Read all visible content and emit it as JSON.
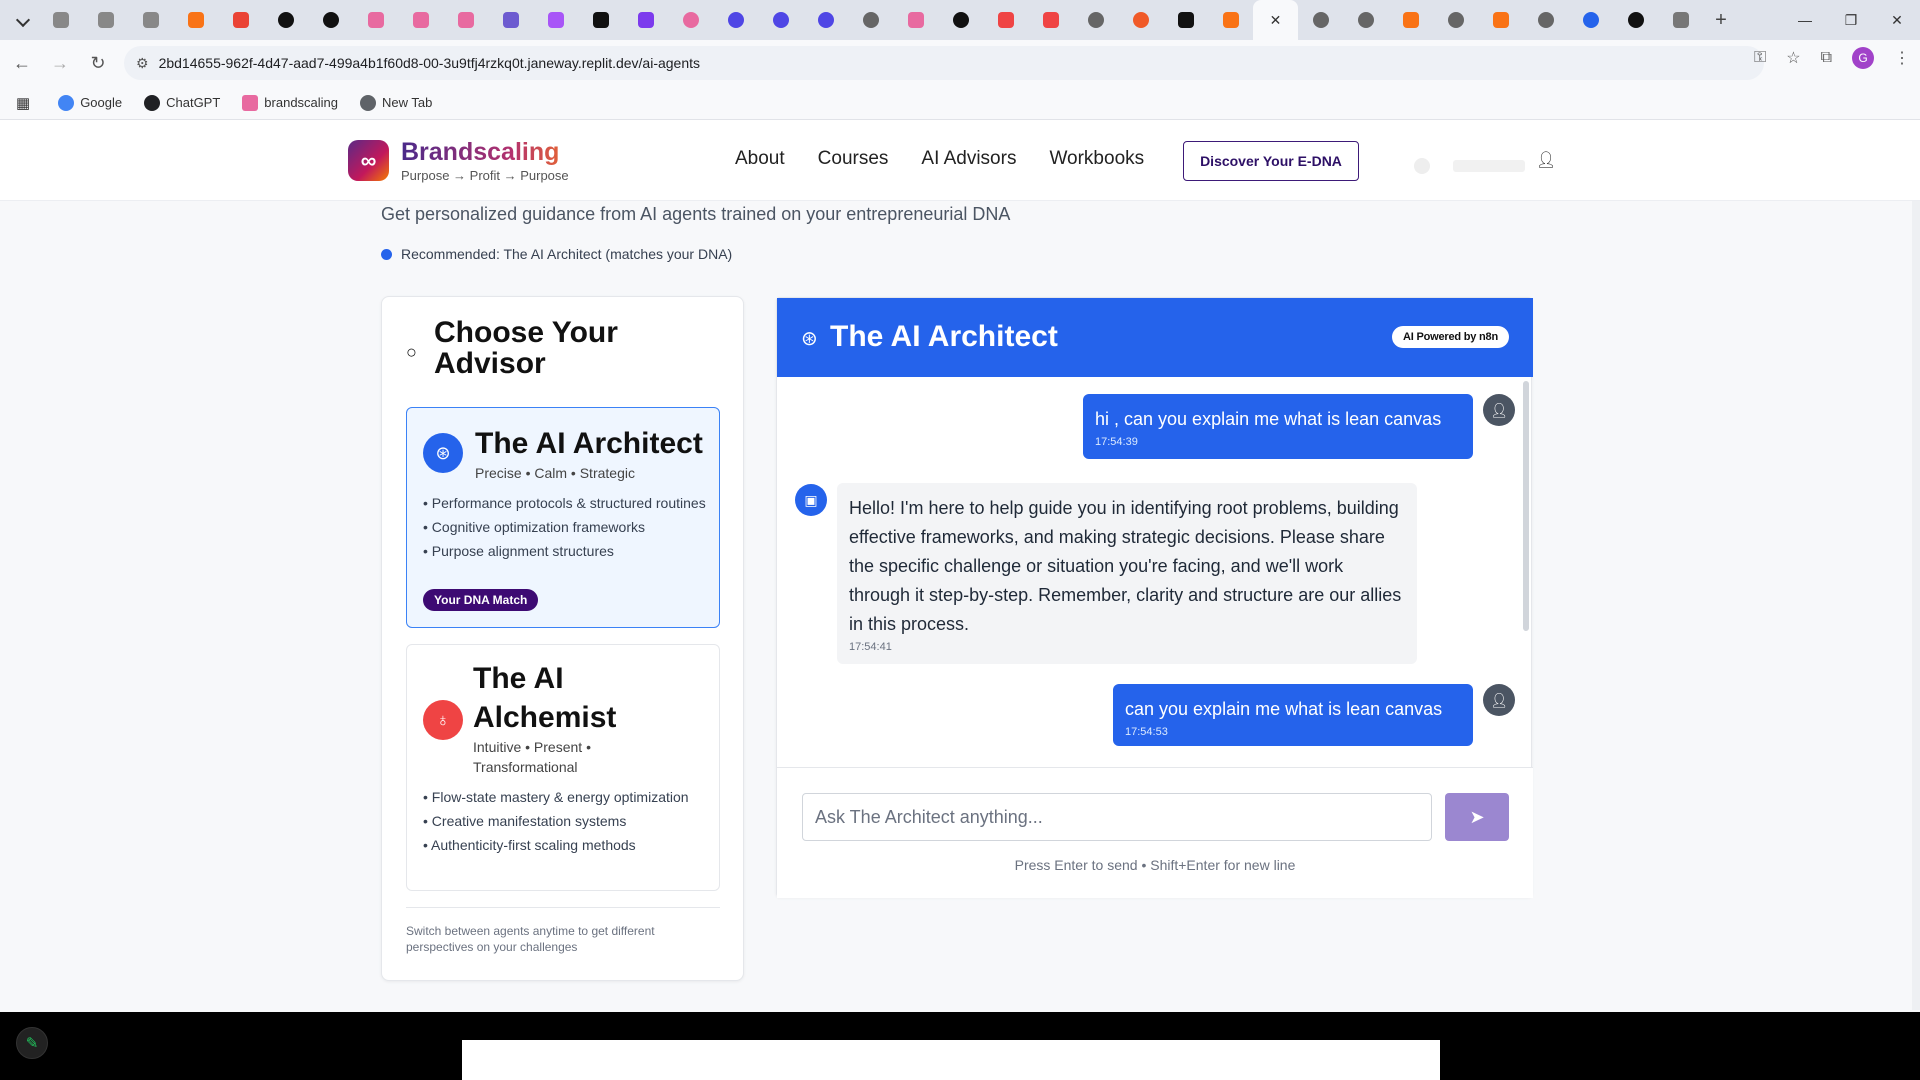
{
  "browser": {
    "url": "2bd14655-962f-4d47-aad7-499a4b1f60d8-00-3u9tfj4rzkq0t.janeway.replit.dev/ai-agents",
    "bookmarks": [
      {
        "label": "Google",
        "icon": "google-icon",
        "color": "#4285f4"
      },
      {
        "label": "ChatGPT",
        "icon": "chatgpt-icon",
        "color": "#202124"
      },
      {
        "label": "brandscaling",
        "icon": "brandscaling-icon",
        "color": "#e86aa0"
      },
      {
        "label": "New Tab",
        "icon": "globe-icon",
        "color": "#5f6368"
      }
    ],
    "profile_initial": "G"
  },
  "site": {
    "brand": "Brandscaling",
    "tagline": "Purpose → Profit → Purpose",
    "nav": [
      "About",
      "Courses",
      "AI Advisors",
      "Workbooks"
    ],
    "cta": "Discover Your E-DNA"
  },
  "hero": {
    "subtitle": "Get personalized guidance from AI agents trained on your entrepreneurial DNA",
    "recommendation": "Recommended: The AI Architect (matches your DNA)"
  },
  "advisor_panel": {
    "title": "Choose Your Advisor",
    "advisors": [
      {
        "name": "The AI Architect",
        "traits": "Precise • Calm • Strategic",
        "points": [
          "Performance protocols & structured routines",
          "Cognitive optimization frameworks",
          "Purpose alignment structures"
        ],
        "badge": "Your DNA Match",
        "accent": "#2563eb"
      },
      {
        "name": "The AI Alchemist",
        "traits": "Intuitive • Present • Transformational",
        "points": [
          "Flow-state mastery & energy optimization",
          "Creative manifestation systems",
          "Authenticity-first scaling methods"
        ],
        "accent": "#ef4444"
      }
    ],
    "footer": "Switch between agents anytime to get different perspectives on your challenges"
  },
  "chat": {
    "title": "The AI Architect",
    "badge": "AI Powered by n8n",
    "messages": [
      {
        "role": "user",
        "text": "hi , can you explain me what is lean canvas",
        "time": "17:54:39"
      },
      {
        "role": "assistant",
        "text": "Hello! I'm here to help guide you in identifying root problems, building effective frameworks, and making strategic decisions. Please share the specific challenge or situation you're facing, and we'll work through it step-by-step. Remember, clarity and structure are our allies in this process.",
        "time": "17:54:41"
      },
      {
        "role": "user",
        "text": "can you explain me what is lean canvas",
        "time": "17:54:53"
      }
    ],
    "input_placeholder": "Ask The Architect anything...",
    "hint": "Press Enter to send • Shift+Enter for new line"
  }
}
